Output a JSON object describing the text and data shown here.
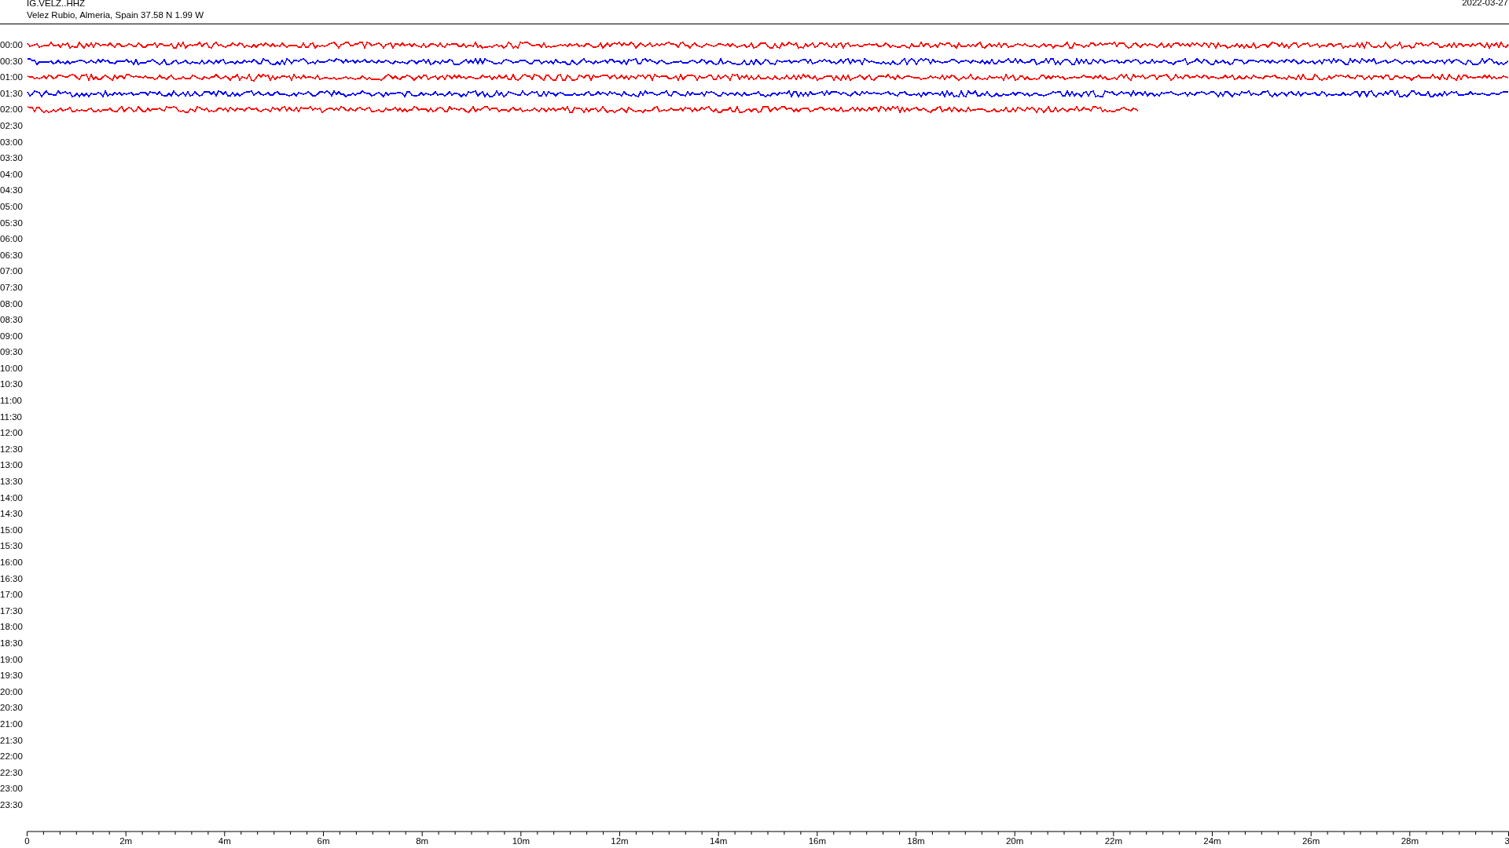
{
  "header": {
    "station": "IG.VELZ..HHZ",
    "location": "Velez Rubio, Almeria, Spain  37.58 N 1.99 W",
    "date": "2022-03-27"
  },
  "rows": [
    {
      "time": "00:00",
      "trace": {
        "color": "#ff0000",
        "kind": "full"
      }
    },
    {
      "time": "00:30",
      "trace": {
        "color": "#0000ff",
        "kind": "full"
      }
    },
    {
      "time": "01:00",
      "trace": {
        "color": "#ff0000",
        "kind": "full"
      }
    },
    {
      "time": "01:30",
      "trace": {
        "color": "#0000ff",
        "kind": "full"
      }
    },
    {
      "time": "02:00",
      "trace": {
        "color": "#ff0000",
        "kind": "partial"
      }
    },
    {
      "time": "02:30"
    },
    {
      "time": "03:00"
    },
    {
      "time": "03:30"
    },
    {
      "time": "04:00"
    },
    {
      "time": "04:30"
    },
    {
      "time": "05:00"
    },
    {
      "time": "05:30"
    },
    {
      "time": "06:00"
    },
    {
      "time": "06:30"
    },
    {
      "time": "07:00"
    },
    {
      "time": "07:30"
    },
    {
      "time": "08:00"
    },
    {
      "time": "08:30"
    },
    {
      "time": "09:00"
    },
    {
      "time": "09:30"
    },
    {
      "time": "10:00"
    },
    {
      "time": "10:30"
    },
    {
      "time": "11:00"
    },
    {
      "time": "11:30"
    },
    {
      "time": "12:00"
    },
    {
      "time": "12:30"
    },
    {
      "time": "13:00"
    },
    {
      "time": "13:30"
    },
    {
      "time": "14:00"
    },
    {
      "time": "14:30"
    },
    {
      "time": "15:00"
    },
    {
      "time": "15:30"
    },
    {
      "time": "16:00"
    },
    {
      "time": "16:30"
    },
    {
      "time": "17:00"
    },
    {
      "time": "17:30"
    },
    {
      "time": "18:00"
    },
    {
      "time": "18:30"
    },
    {
      "time": "19:00"
    },
    {
      "time": "19:30"
    },
    {
      "time": "20:00"
    },
    {
      "time": "20:30"
    },
    {
      "time": "21:00"
    },
    {
      "time": "21:30"
    },
    {
      "time": "22:00"
    },
    {
      "time": "22:30"
    },
    {
      "time": "23:00"
    },
    {
      "time": "23:30"
    }
  ],
  "x_axis": {
    "labels": [
      "0",
      "2m",
      "4m",
      "6m",
      "8m",
      "10m",
      "12m",
      "14m",
      "16m",
      "18m",
      "20m",
      "22m",
      "24m",
      "26m",
      "28m",
      "3"
    ]
  }
}
